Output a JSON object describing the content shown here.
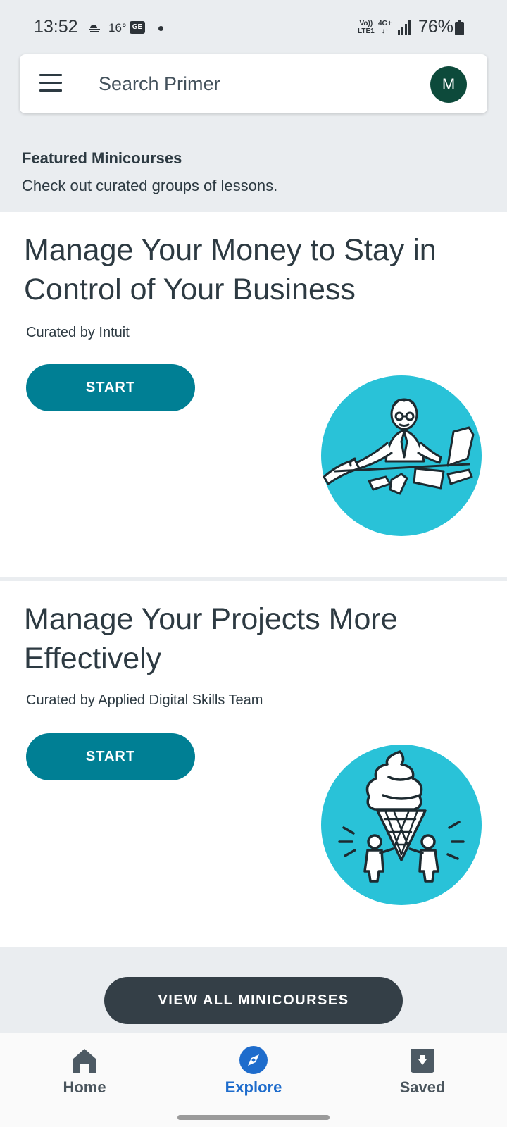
{
  "status_bar": {
    "time": "13:52",
    "temperature": "16°",
    "ge_badge": "GE",
    "volte": "Vo))\nLTE1",
    "network": "4G+\n↓↑",
    "battery": "76%"
  },
  "search": {
    "placeholder": "Search Primer"
  },
  "avatar": {
    "initial": "M"
  },
  "featured": {
    "title": "Featured Minicourses",
    "subtitle": "Check out curated groups of lessons."
  },
  "courses": [
    {
      "title": "Manage Your Money to Stay in Control of Your Business",
      "curator": "Curated by Intuit",
      "button": "START",
      "illustration": "businessman-with-receipts-illustration"
    },
    {
      "title": "Manage Your Projects More Effectively",
      "curator": "Curated by Applied Digital Skills Team",
      "button": "START",
      "illustration": "people-holding-ice-cream-illustration"
    }
  ],
  "view_all": "VIEW ALL MINICOURSES",
  "bottom_nav": [
    {
      "label": "Home",
      "icon": "home-icon"
    },
    {
      "label": "Explore",
      "icon": "compass-icon",
      "active": true
    },
    {
      "label": "Saved",
      "icon": "archive-icon"
    }
  ],
  "colors": {
    "accent_teal": "#007f94",
    "illustration_circle": "#29c2d8",
    "avatar_green": "#0d4a3b",
    "active_nav": "#1e6ccc",
    "dark_button": "#343f47"
  }
}
